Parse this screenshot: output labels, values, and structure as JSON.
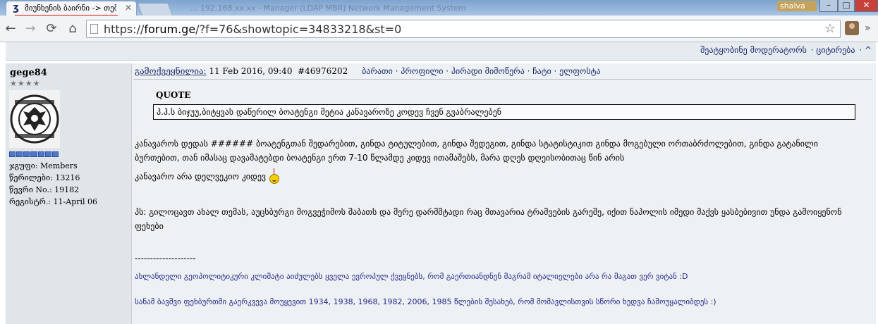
{
  "browser": {
    "tab_title": "მიუნხენის ბაირნი -> თემ",
    "tab_favicon": "ʒ",
    "user_badge": "shalva",
    "url": "https://forum.ge/?f=76&showtopic=34833218&st=0",
    "url_scheme": "https://",
    "url_host": "forum.ge",
    "url_path": "/?f=76&showtopic=34833218&st=0",
    "ghost_title": "... 192.168.xx.xx - Manager (LDAP MBR) Network Management System"
  },
  "topbar": {
    "links": [
      "შეატყობინე მოდერატორს",
      "· ციტირება",
      "· ^"
    ]
  },
  "author": {
    "name": "gege84",
    "stars": "★★★★",
    "group": "ჯგუფი: Members",
    "posts": "წერილები: 13216",
    "member_no": "წევრი No.: 19182",
    "registered": "რეგისტრ.: 11-April 06"
  },
  "post": {
    "published_label": "გამოქვეყნილია:",
    "date": " 11 Feb 2016, 09:40",
    "post_id": "#46976202",
    "actions": "ბარათი · პროფილი · პირადი მიმოწერა · ჩატი · ელფოსტა",
    "quote_label": "QUOTE",
    "quote_text": "პ.ჰ.ს ბიჯუუ,ბიტყვას დაწერილ ბოატენგი მეტია კანავაროზე კოდევ ჩვენ გვაბრალებენ",
    "para1": "კანავაროს დედას ###### ბოატენგთან შედარებით, გინდა ტიტულებით, გინდა შედეგით, გინდა სტატისტიკით გინდა მოგებული ორთაბრძოლებით, გინდა გატანილი ბურთებით, თან იმასაც დავამატებდი ბოატენგი ერთ 7-10 წლამდე კიდევ ითამაშებს, მარა დღეს დღეისობითაც წინ არის",
    "para2": "კანავარო არა დელვეკიო კიდევ",
    "para3": "პს: გილოცავთ ახალ თემას, აუცსბურგი მოგვეჭიმოს შაბათს და მერე დარმშტადი რაც მთავარია ტრამვების გარეშე, იქით ნაპოლის იმედი მაქვს ყასბებივით უნდა გამოიყენონ ფეხები",
    "separator": "--------------------",
    "sig1": "ახლანდელი გეოპოლიტიკური კლიმატი აიძულებს ყველა ევროპულ ქვეყნებს, რომ გაერთიანდნენ მაგრამ იტალიელები არა რა მაგათ ვერ ვიტან :D",
    "sig2": "სანამ ბავშვი ფეხბურთში გაერკვევა მოუყევით 1934, 1938, 1968, 1982, 2006, 1985 წლების შესახებ, რომ მომავლისთვის სწორი ხედვა ჩამოუყალიბდეს :)"
  },
  "colors": {
    "link": "#1b2a6e",
    "signature": "#23278b",
    "tab_underline": "#d0121b"
  }
}
